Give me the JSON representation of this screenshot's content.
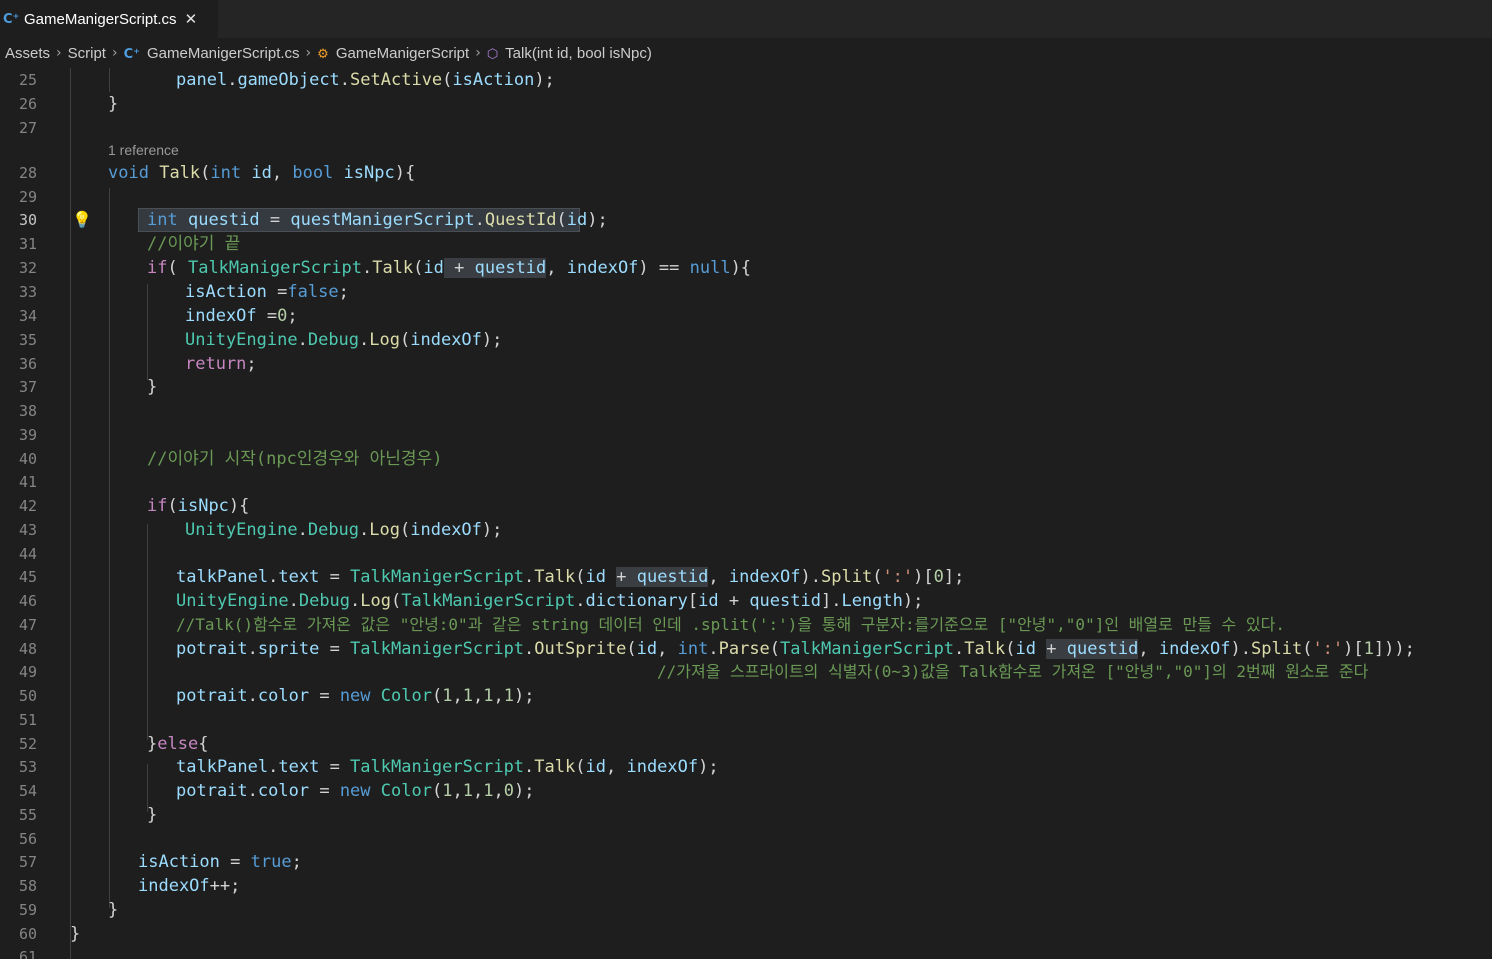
{
  "tab": {
    "filename": "GameManigerScript.cs",
    "close_glyph": "✕",
    "icon": "csharp-file-icon"
  },
  "breadcrumb": {
    "items": [
      "Assets",
      "Script",
      "GameManigerScript.cs",
      "GameManigerScript",
      "Talk(int id, bool isNpc)"
    ],
    "separator": "›"
  },
  "editor": {
    "active_line": "30",
    "codelens": "1 reference",
    "lightbulb": "💡",
    "line_numbers": [
      "25",
      "26",
      "27",
      "28",
      "29",
      "30",
      "31",
      "32",
      "33",
      "34",
      "35",
      "36",
      "37",
      "38",
      "39",
      "40",
      "41",
      "42",
      "43",
      "44",
      "45",
      "46",
      "47",
      "48",
      "49",
      "50",
      "51",
      "52",
      "53",
      "54",
      "55",
      "56",
      "57",
      "58",
      "59",
      "60",
      "61"
    ],
    "tokens": {
      "panel": "panel",
      "gameObject": "gameObject",
      "SetActive": "SetActive",
      "isAction": "isAction",
      "void": "void",
      "Talk": "Talk",
      "int": "int",
      "id": "id",
      "bool": "bool",
      "isNpc": "isNpc",
      "questid": "questid",
      "questManigerScript": "questManigerScript",
      "QuestId": "QuestId",
      "comment31": "//이야기 끝",
      "if": "if",
      "TalkManigerScript": "TalkManigerScript",
      "indexOf": "indexOf",
      "null": "null",
      "false": "false",
      "zero": "0",
      "one": "1",
      "UnityEngine": "UnityEngine",
      "Debug": "Debug",
      "Log": "Log",
      "return": "return",
      "comment40": "//이야기 시작(npc인경우와 아닌경우)",
      "talkPanel": "talkPanel",
      "text": "text",
      "Split": "Split",
      "colon_str": "':'",
      "dictionary": "dictionary",
      "Length": "Length",
      "comment47": "//Talk()함수로 가져온 값은 \"안녕:0\"과 같은 string 데이터 인데 .split(':')을 통해 구분자:를기준으로 [\"안녕\",\"0\"]인 배열로 만들 수 있다.",
      "potrait": "potrait",
      "sprite": "sprite",
      "OutSprite": "OutSprite",
      "Parse": "Parse",
      "comment49": "//가져올 스프라이트의 식별자(0~3)값을 Talk함수로 가져온 [\"안녕\",\"0\"]의 2번째 원소로 준다",
      "color": "color",
      "new": "new",
      "Color": "Color",
      "else": "else",
      "true": "true"
    }
  }
}
